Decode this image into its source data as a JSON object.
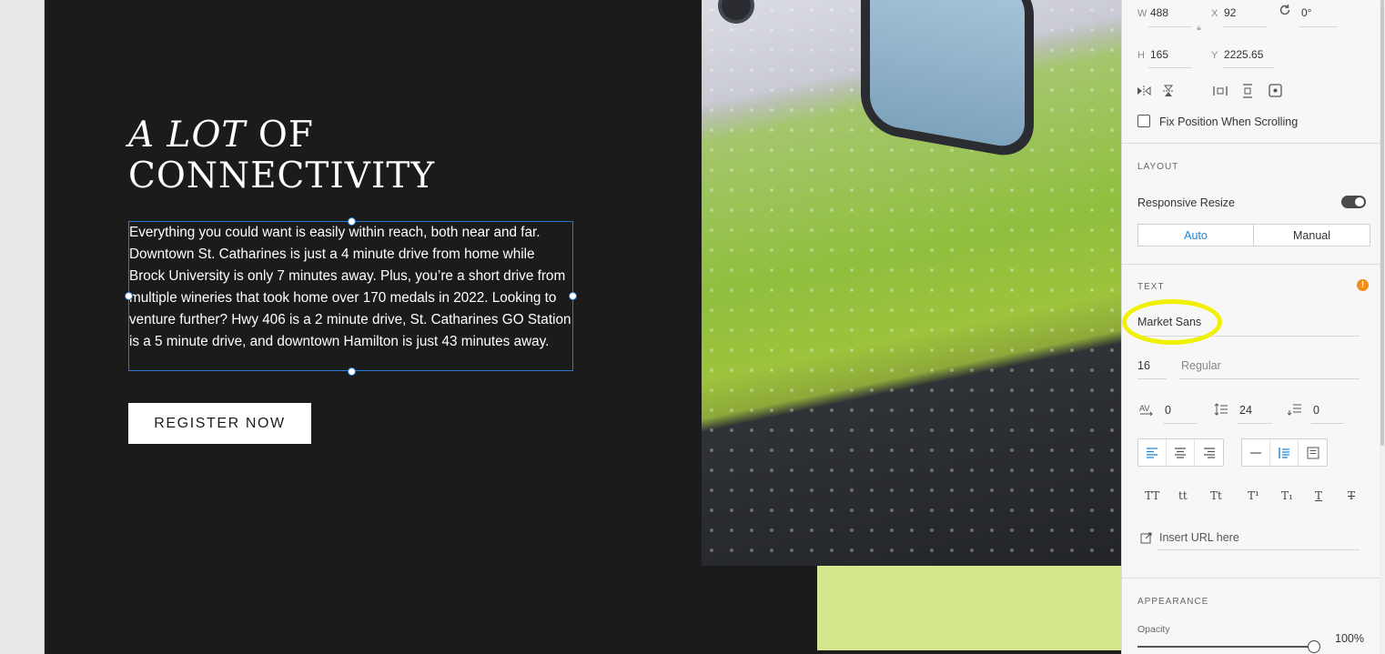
{
  "canvas": {
    "headline_italic": "A LOT",
    "headline_rest": " OF",
    "headline_line2": "CONNECTIVITY",
    "body": "Everything you could want is easily within reach, both near and far. Downtown St. Catharines is just a 4 minute drive from home while Brock University is only 7 minutes away. Plus, you’re a short drive from multiple wineries that took home over 170 medals in 2022. Looking to venture further? Hwy 406 is a 2 minute drive, St. Catharines GO Station is a 5 minute drive, and downtown Hamilton is just 43 minutes away.",
    "cta_label": "REGISTER NOW"
  },
  "inspector": {
    "transform": {
      "w_label": "W",
      "w_value": "488",
      "x_label": "X",
      "x_value": "92",
      "rotation_value": "0°",
      "h_label": "H",
      "h_value": "165",
      "y_label": "Y",
      "y_value": "2225.65"
    },
    "fix_position_label": "Fix Position When Scrolling",
    "layout": {
      "title": "LAYOUT",
      "responsive_label": "Responsive Resize",
      "responsive_on": true,
      "auto_label": "Auto",
      "manual_label": "Manual"
    },
    "text": {
      "title": "TEXT",
      "font_family": "Market Sans",
      "font_size": "16",
      "font_style": "Regular",
      "char_spacing": "0",
      "line_spacing": "24",
      "paragraph_spacing": "0",
      "case_buttons": [
        "TT",
        "tt",
        "Tt",
        "T¹",
        "T₁",
        "T",
        "T"
      ],
      "url_placeholder": "Insert URL here"
    },
    "appearance": {
      "title": "APPEARANCE",
      "opacity_label": "Opacity",
      "opacity_value": "100%"
    }
  },
  "colors": {
    "artboard_bg": "#1b1b1c",
    "accent_blue": "#1a86d8",
    "highlight_yellow": "#f0f000",
    "lime_block": "#d4e78c",
    "warning_orange": "#f08c1a"
  }
}
